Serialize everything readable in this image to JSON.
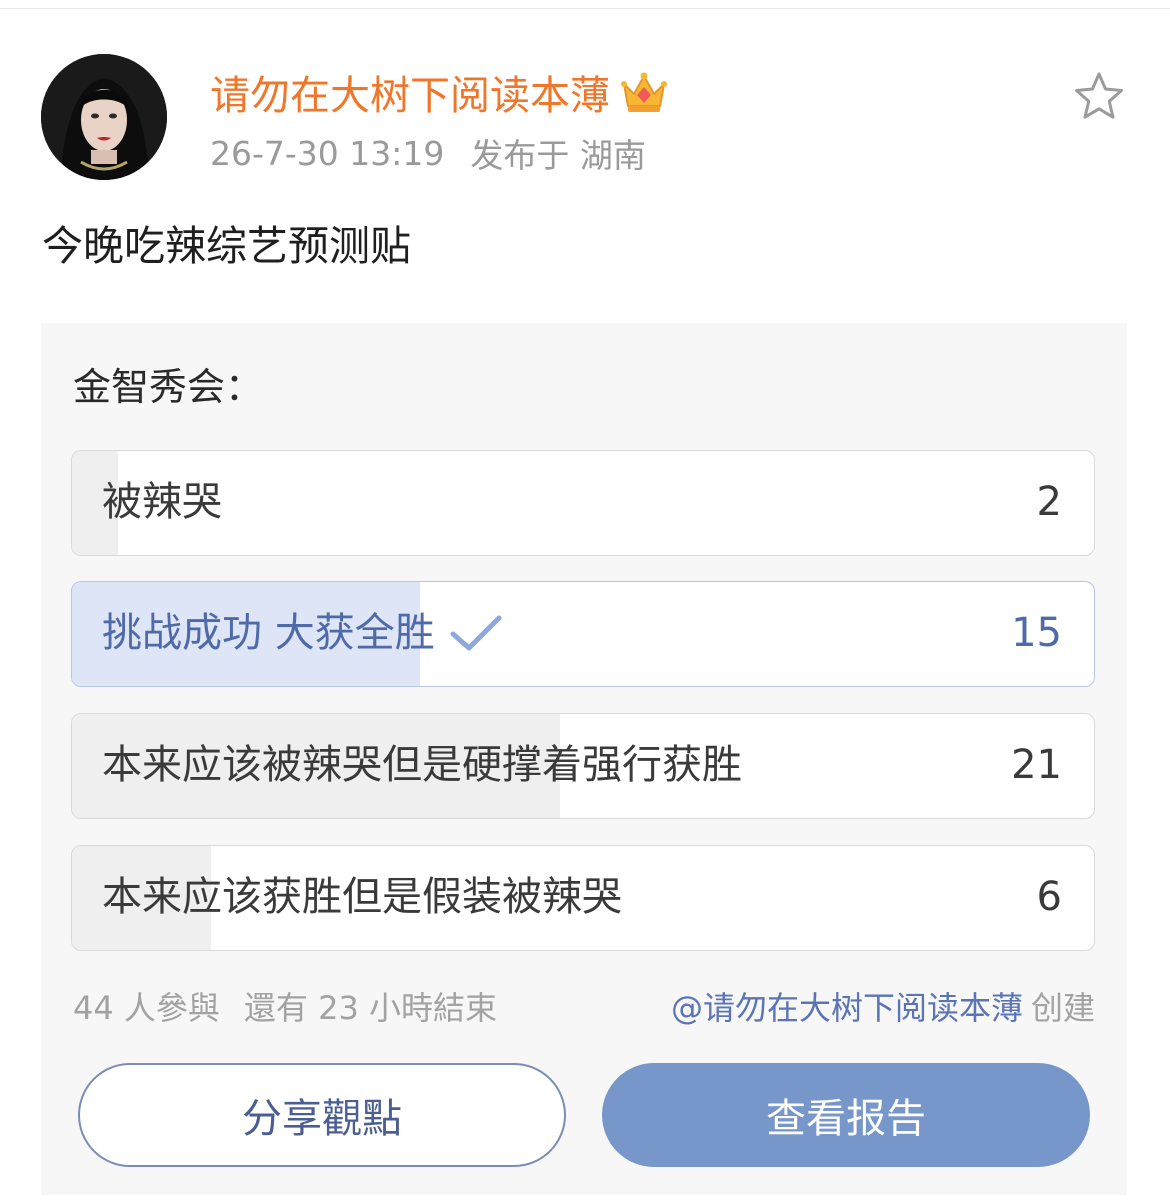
{
  "post": {
    "author_name": "请勿在大树下阅读本薄",
    "timestamp": "26-7-30 13:19",
    "location": "发布于 湖南",
    "text": "今晚吃辣综艺预测贴"
  },
  "icons": {
    "badge": "crown-icon",
    "favorite": "star-icon",
    "selected_mark": "check-icon"
  },
  "colors": {
    "author_name": "#f0762a",
    "accent_blue": "#5b74b5",
    "report_button": "#7797ca"
  },
  "poll": {
    "title": "金智秀会：",
    "total_votes": 44,
    "options": [
      {
        "label": "被辣哭",
        "count": "2",
        "selected": false
      },
      {
        "label": "挑战成功 大获全胜",
        "count": "15",
        "selected": true
      },
      {
        "label": "本来应该被辣哭但是硬撑着强行获胜",
        "count": "21",
        "selected": false
      },
      {
        "label": "本来应该获胜但是假装被辣哭",
        "count": "6",
        "selected": false
      }
    ],
    "participants": "44 人參與",
    "time_left": "還有 23 小時結束",
    "creator": "@请勿在大树下阅读本薄",
    "created_label": "创建",
    "share_button": "分享觀點",
    "report_button": "查看报告"
  }
}
